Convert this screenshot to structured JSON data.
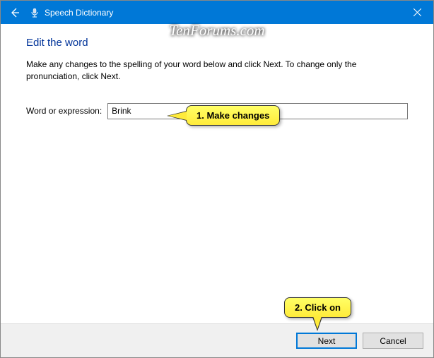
{
  "titlebar": {
    "title": "Speech Dictionary"
  },
  "watermark": "TenForums.com",
  "page": {
    "heading": "Edit the word",
    "instruction": "Make any changes to the spelling of your word below and click Next.  To change only the pronunciation, click Next.",
    "field_label": "Word or expression:",
    "field_value": "Brink"
  },
  "buttons": {
    "next": "Next",
    "cancel": "Cancel"
  },
  "callouts": {
    "step1": "1. Make changes",
    "step2": "2. Click on"
  }
}
